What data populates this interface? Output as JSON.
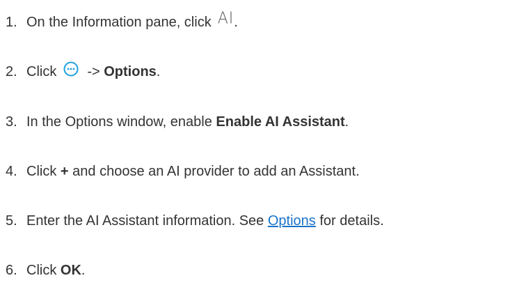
{
  "steps": [
    {
      "num": "1.",
      "text": "On the Information pane, click",
      "icon": "ai-icon",
      "icon_text": "AI",
      "after": "."
    },
    {
      "num": "2.",
      "prefix": "Click",
      "icon": "more-options-icon",
      "middle": "->",
      "bold": "Options",
      "after": "."
    },
    {
      "num": "3.",
      "text": "In the Options window, enable",
      "bold": "Enable AI Assistant",
      "after": "."
    },
    {
      "num": "4.",
      "prefix": "Click",
      "bold": "+",
      "text": "and choose an AI provider to add an Assistant."
    },
    {
      "num": "5.",
      "text": "Enter the AI Assistant information. See",
      "link": "Options",
      "after": "for details."
    },
    {
      "num": "6.",
      "prefix": "Click",
      "bold": "OK",
      "after": "."
    }
  ],
  "colors": {
    "text": "#333333",
    "link": "#1a73c9",
    "icon_accent": "#1fa0e0"
  }
}
